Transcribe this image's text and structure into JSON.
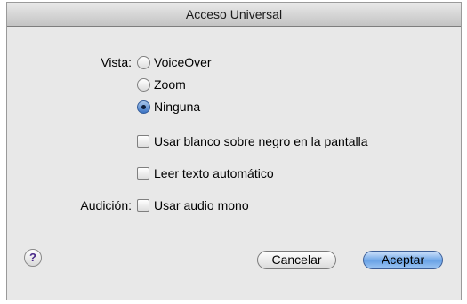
{
  "window": {
    "title": "Acceso Universal"
  },
  "vista": {
    "label": "Vista:",
    "options": [
      {
        "label": "VoiceOver",
        "checked": false
      },
      {
        "label": "Zoom",
        "checked": false
      },
      {
        "label": "Ninguna",
        "checked": true
      }
    ],
    "checkboxes": [
      {
        "label": "Usar blanco sobre negro en la pantalla",
        "checked": false
      },
      {
        "label": "Leer texto automático",
        "checked": false
      }
    ]
  },
  "audicion": {
    "label": "Audición:",
    "checkboxes": [
      {
        "label": "Usar audio mono",
        "checked": false
      }
    ]
  },
  "help": {
    "glyph": "?"
  },
  "buttons": {
    "cancel": "Cancelar",
    "ok": "Aceptar"
  }
}
